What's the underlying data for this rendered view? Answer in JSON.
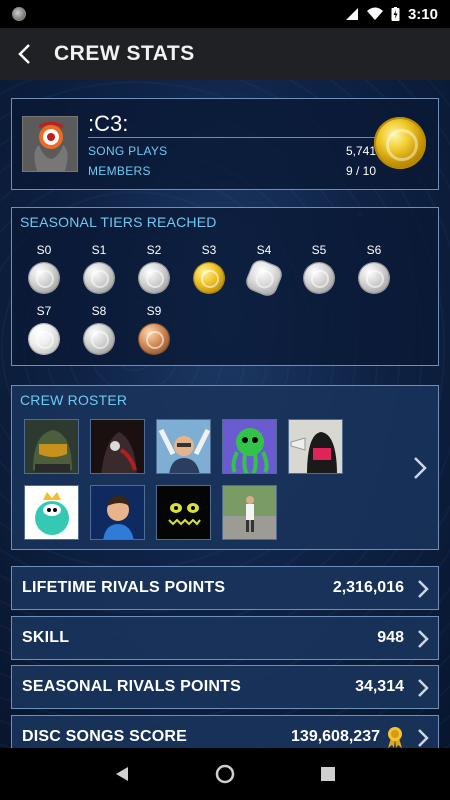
{
  "status_bar": {
    "time": "3:10"
  },
  "app_bar": {
    "title": "CREW STATS"
  },
  "crew": {
    "name": ":C3:",
    "song_plays_label": "SONG PLAYS",
    "song_plays_value": "5,741",
    "members_label": "MEMBERS",
    "members_value": "9 / 10"
  },
  "tiers": {
    "title": "SEASONAL TIERS REACHED",
    "items": [
      {
        "label": "S0",
        "medal": "silver"
      },
      {
        "label": "S1",
        "medal": "silver"
      },
      {
        "label": "S2",
        "medal": "silver"
      },
      {
        "label": "S3",
        "medal": "gold"
      },
      {
        "label": "S4",
        "medal": "platinum"
      },
      {
        "label": "S5",
        "medal": "silver"
      },
      {
        "label": "S6",
        "medal": "silver"
      },
      {
        "label": "S7",
        "medal": "pearl"
      },
      {
        "label": "S8",
        "medal": "silver"
      },
      {
        "label": "S9",
        "medal": "bronze"
      }
    ]
  },
  "roster": {
    "title": "CREW ROSTER",
    "avatars": [
      "helmet-avatar",
      "dark-creature-avatar",
      "waving-man-avatar",
      "green-octopus-avatar",
      "masked-figure-avatar",
      "crowned-character-avatar",
      "cartoon-boy-avatar",
      "dark-smile-avatar",
      "person-on-street-avatar"
    ]
  },
  "stats": [
    {
      "label": "LIFETIME RIVALS POINTS",
      "value": "2,316,016"
    },
    {
      "label": "SKILL",
      "value": "948"
    },
    {
      "label": "SEASONAL RIVALS POINTS",
      "value": "34,314"
    },
    {
      "label": "DISC SONGS SCORE",
      "value": "139,608,237"
    }
  ],
  "colors": {
    "accent": "#6fc9f2",
    "panel_border": "#6f8fb8",
    "background": "#0f2346",
    "app_bar": "#202124"
  }
}
